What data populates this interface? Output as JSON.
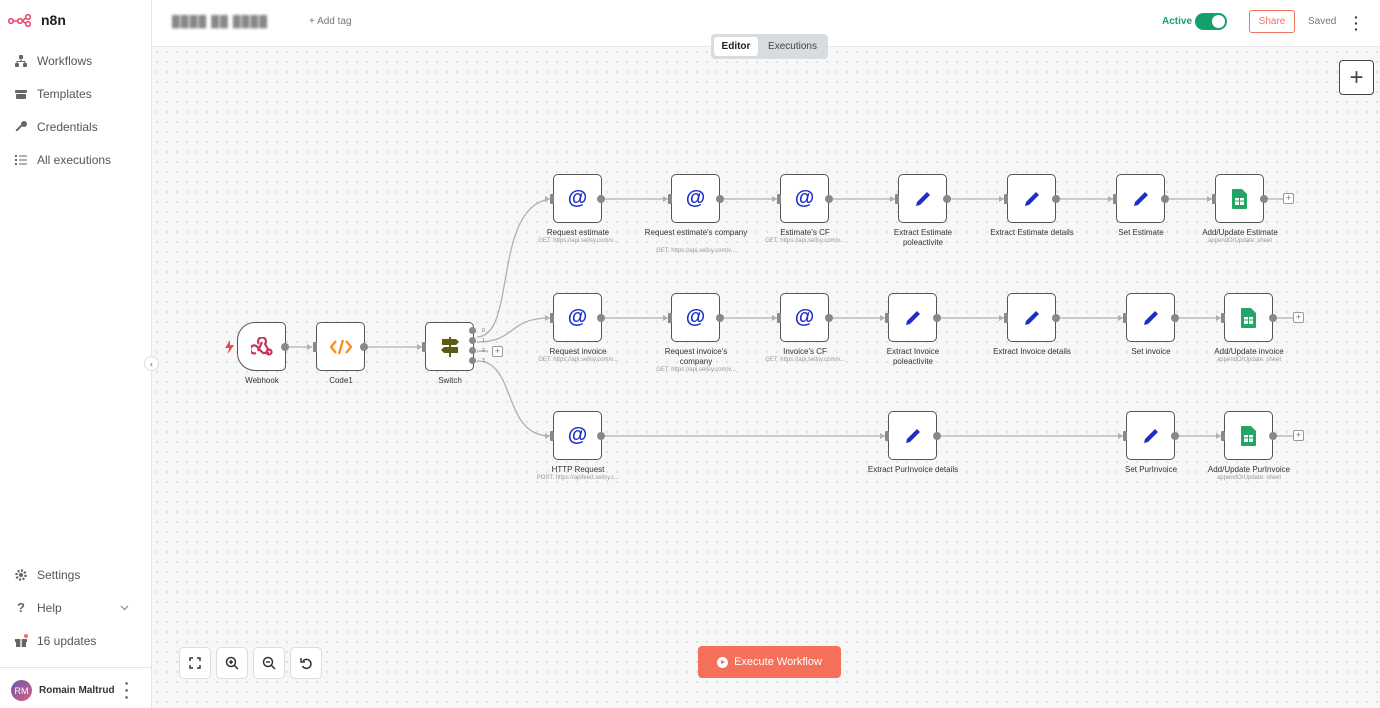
{
  "app": {
    "logo_text": "n8n"
  },
  "sidebar": {
    "items": [
      {
        "label": "Workflows",
        "icon": "workflows-icon"
      },
      {
        "label": "Templates",
        "icon": "templates-icon"
      },
      {
        "label": "Credentials",
        "icon": "key-icon"
      },
      {
        "label": "All executions",
        "icon": "list-icon"
      }
    ],
    "bottom_items": [
      {
        "label": "Settings",
        "icon": "gear-icon"
      },
      {
        "label": "Help",
        "icon": "question-icon"
      },
      {
        "label": "16 updates",
        "icon": "gift-icon"
      }
    ],
    "user": {
      "initials": "RM",
      "name": "Romain Maltrud"
    }
  },
  "header": {
    "workflow_name": "████ ██ ████",
    "add_tag": "+ Add tag",
    "active_label": "Active",
    "active": true,
    "share": "Share",
    "saved": "Saved"
  },
  "tabs": [
    {
      "label": "Editor",
      "active": true
    },
    {
      "label": "Executions",
      "active": false
    }
  ],
  "nodes": [
    {
      "id": "webhook",
      "label": "Webhook",
      "sub": "",
      "kind": "webhook"
    },
    {
      "id": "code1",
      "label": "Code1",
      "sub": "",
      "kind": "code"
    },
    {
      "id": "switch",
      "label": "Switch",
      "sub": "",
      "kind": "switch"
    },
    {
      "id": "req_est",
      "label": "Request estimate",
      "sub": "GET: https://api.sellsy.com/v...",
      "kind": "http"
    },
    {
      "id": "req_est_comp",
      "label": "Request estimate's company",
      "sub": "GET: https://api.sellsy.com/v...",
      "kind": "http"
    },
    {
      "id": "est_cf",
      "label": "Estimate's CF",
      "sub": "GET: https://api.sellsy.com/v...",
      "kind": "http"
    },
    {
      "id": "ext_est_pole",
      "label": "Extract Estimate poleactivite",
      "sub": "",
      "kind": "set"
    },
    {
      "id": "ext_est_det",
      "label": "Extract Estimate details",
      "sub": "",
      "kind": "set"
    },
    {
      "id": "set_est",
      "label": "Set Estimate",
      "sub": "",
      "kind": "set"
    },
    {
      "id": "add_est",
      "label": "Add/Update Estimate",
      "sub": "appendOrUpdate: sheet",
      "kind": "sheets"
    },
    {
      "id": "req_inv",
      "label": "Request invoice",
      "sub": "GET: https://api.sellsy.com/v...",
      "kind": "http"
    },
    {
      "id": "req_inv_comp",
      "label": "Request invoice's company",
      "sub": "GET: https://api.sellsy.com/v...",
      "kind": "http"
    },
    {
      "id": "inv_cf",
      "label": "Invoice's CF",
      "sub": "GET: https://api.sellsy.com/v...",
      "kind": "http"
    },
    {
      "id": "ext_inv_pole",
      "label": "Extract Invoice poleactivite",
      "sub": "",
      "kind": "set"
    },
    {
      "id": "ext_inv_det",
      "label": "Extract Invoice details",
      "sub": "",
      "kind": "set"
    },
    {
      "id": "set_inv",
      "label": "Set invoice",
      "sub": "",
      "kind": "set"
    },
    {
      "id": "add_inv",
      "label": "Add/Update invoice",
      "sub": "appendOrUpdate: sheet",
      "kind": "sheets"
    },
    {
      "id": "http_req",
      "label": "HTTP Request",
      "sub": "POST: https://apifeed.sellsy.c...",
      "kind": "http"
    },
    {
      "id": "ext_pur",
      "label": "Extract PurInvoice details",
      "sub": "",
      "kind": "set"
    },
    {
      "id": "set_pur",
      "label": "Set PurInvoice",
      "sub": "",
      "kind": "set"
    },
    {
      "id": "add_pur",
      "label": "Add/Update PurInvoice",
      "sub": "appendOrUpdate: sheet",
      "kind": "sheets"
    }
  ],
  "switch_outputs": [
    "0",
    "1",
    "2",
    "3"
  ],
  "execute_button": "Execute Workflow",
  "colors": {
    "accent": "#f5705a",
    "active_green": "#13a06c",
    "http_blue": "#1c2ec4",
    "sheets_green": "#23a566"
  }
}
